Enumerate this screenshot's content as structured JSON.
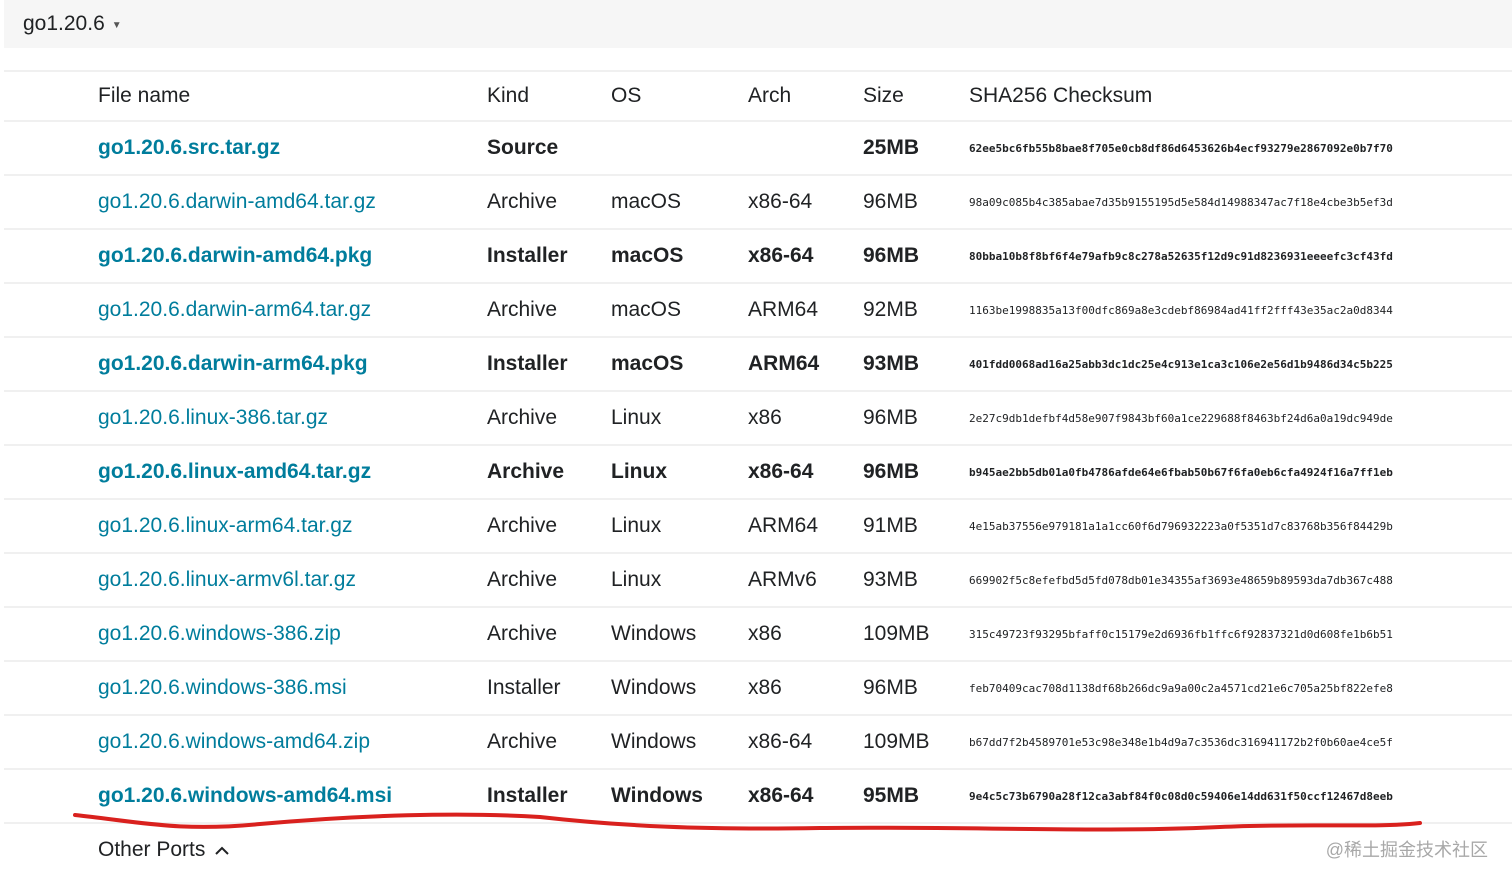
{
  "version": {
    "label": "go1.20.6"
  },
  "table": {
    "headers": {
      "file": "File name",
      "kind": "Kind",
      "os": "OS",
      "arch": "Arch",
      "size": "Size",
      "sha": "SHA256 Checksum"
    },
    "rows": [
      {
        "file": "go1.20.6.src.tar.gz",
        "kind": "Source",
        "os": "",
        "arch": "",
        "size": "25MB",
        "sha": "62ee5bc6fb55b8bae8f705e0cb8df86d6453626b4ecf93279e2867092e0b7f70",
        "highlight": true
      },
      {
        "file": "go1.20.6.darwin-amd64.tar.gz",
        "kind": "Archive",
        "os": "macOS",
        "arch": "x86-64",
        "size": "96MB",
        "sha": "98a09c085b4c385abae7d35b9155195d5e584d14988347ac7f18e4cbe3b5ef3d",
        "highlight": false
      },
      {
        "file": "go1.20.6.darwin-amd64.pkg",
        "kind": "Installer",
        "os": "macOS",
        "arch": "x86-64",
        "size": "96MB",
        "sha": "80bba10b8f8bf6f4e79afb9c8c278a52635f12d9c91d8236931eeeefc3cf43fd",
        "highlight": true
      },
      {
        "file": "go1.20.6.darwin-arm64.tar.gz",
        "kind": "Archive",
        "os": "macOS",
        "arch": "ARM64",
        "size": "92MB",
        "sha": "1163be1998835a13f00dfc869a8e3cdebf86984ad41ff2fff43e35ac2a0d8344",
        "highlight": false
      },
      {
        "file": "go1.20.6.darwin-arm64.pkg",
        "kind": "Installer",
        "os": "macOS",
        "arch": "ARM64",
        "size": "93MB",
        "sha": "401fdd0068ad16a25abb3dc1dc25e4c913e1ca3c106e2e56d1b9486d34c5b225",
        "highlight": true
      },
      {
        "file": "go1.20.6.linux-386.tar.gz",
        "kind": "Archive",
        "os": "Linux",
        "arch": "x86",
        "size": "96MB",
        "sha": "2e27c9db1defbf4d58e907f9843bf60a1ce229688f8463bf24d6a0a19dc949de",
        "highlight": false
      },
      {
        "file": "go1.20.6.linux-amd64.tar.gz",
        "kind": "Archive",
        "os": "Linux",
        "arch": "x86-64",
        "size": "96MB",
        "sha": "b945ae2bb5db01a0fb4786afde64e6fbab50b67f6fa0eb6cfa4924f16a7ff1eb",
        "highlight": true
      },
      {
        "file": "go1.20.6.linux-arm64.tar.gz",
        "kind": "Archive",
        "os": "Linux",
        "arch": "ARM64",
        "size": "91MB",
        "sha": "4e15ab37556e979181a1a1cc60f6d796932223a0f5351d7c83768b356f84429b",
        "highlight": false
      },
      {
        "file": "go1.20.6.linux-armv6l.tar.gz",
        "kind": "Archive",
        "os": "Linux",
        "arch": "ARMv6",
        "size": "93MB",
        "sha": "669902f5c8efefbd5d5fd078db01e34355af3693e48659b89593da7db367c488",
        "highlight": false
      },
      {
        "file": "go1.20.6.windows-386.zip",
        "kind": "Archive",
        "os": "Windows",
        "arch": "x86",
        "size": "109MB",
        "sha": "315c49723f93295bfaff0c15179e2d6936fb1ffc6f92837321d0d608fe1b6b51",
        "highlight": false
      },
      {
        "file": "go1.20.6.windows-386.msi",
        "kind": "Installer",
        "os": "Windows",
        "arch": "x86",
        "size": "96MB",
        "sha": "feb70409cac708d1138df68b266dc9a9a00c2a4571cd21e6c705a25bf822efe8",
        "highlight": false
      },
      {
        "file": "go1.20.6.windows-amd64.zip",
        "kind": "Archive",
        "os": "Windows",
        "arch": "x86-64",
        "size": "109MB",
        "sha": "b67dd7f2b4589701e53c98e348e1b4d9a7c3536dc316941172b2f0b60ae4ce5f",
        "highlight": false
      },
      {
        "file": "go1.20.6.windows-amd64.msi",
        "kind": "Installer",
        "os": "Windows",
        "arch": "x86-64",
        "size": "95MB",
        "sha": "9e4c5c73b6790a28f12ca3abf84f0c08d0c59406e14dd631f50ccf12467d8eeb",
        "highlight": true
      }
    ]
  },
  "other_ports": {
    "label": "Other Ports"
  },
  "watermark": {
    "text": "@稀土掘金技术社区"
  },
  "colors": {
    "link": "#007d9c",
    "annotation": "#d9211e"
  }
}
